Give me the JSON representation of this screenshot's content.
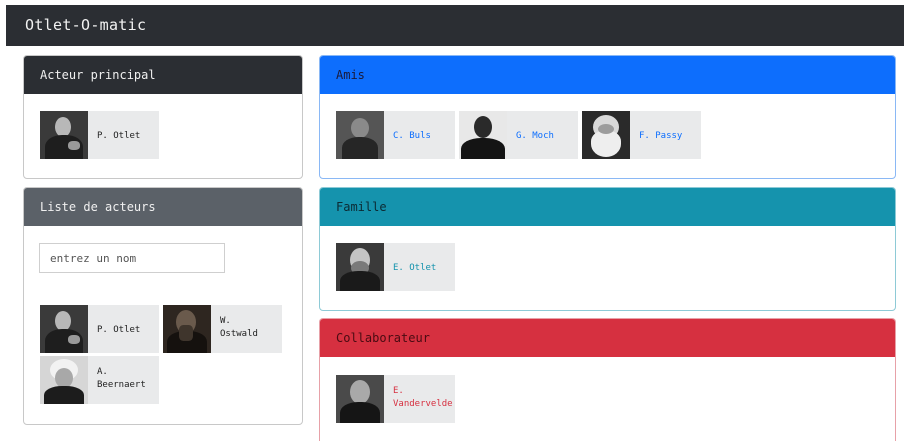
{
  "app": {
    "title": "Otlet-O-matic"
  },
  "colors": {
    "link_blue": "#0d6efd",
    "link_teal": "#1593ad",
    "link_red": "#d63040",
    "dark_text": "#222222"
  },
  "main_actor": {
    "header": "Acteur principal",
    "people": [
      {
        "name": "P. Otlet",
        "photo_icon": "portrait-photo"
      }
    ]
  },
  "actor_list": {
    "header": "Liste de acteurs",
    "search": {
      "placeholder": "entrez un nom",
      "value": ""
    },
    "people": [
      {
        "name": "P. Otlet",
        "photo_icon": "portrait-photo"
      },
      {
        "name": "W. Ostwald",
        "photo_icon": "portrait-photo"
      },
      {
        "name": "A. Beernaert",
        "photo_icon": "portrait-photo"
      }
    ]
  },
  "amis": {
    "header": "Amis",
    "people": [
      {
        "name": "C. Buls",
        "photo_icon": "portrait-photo"
      },
      {
        "name": "G. Moch",
        "photo_icon": "portrait-photo"
      },
      {
        "name": "F. Passy",
        "photo_icon": "portrait-photo"
      }
    ]
  },
  "famille": {
    "header": "Famille",
    "people": [
      {
        "name": "E. Otlet",
        "photo_icon": "portrait-photo"
      }
    ]
  },
  "collaborateur": {
    "header": "Collaborateur",
    "people": [
      {
        "name": "E. Vandervelde",
        "photo_icon": "portrait-photo"
      }
    ]
  }
}
